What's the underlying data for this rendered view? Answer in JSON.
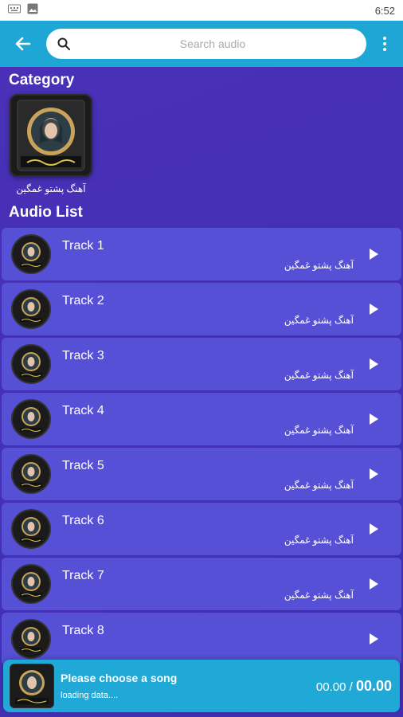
{
  "status_bar": {
    "time": "6:52"
  },
  "search": {
    "placeholder": "Search audio"
  },
  "category": {
    "heading": "Category",
    "items": [
      {
        "name": "آهنگ پشتو غمگین"
      }
    ]
  },
  "audio_list": {
    "heading": "Audio List",
    "tracks": [
      {
        "title": "Track 1",
        "subtitle": "آهنگ پشتو غمگین"
      },
      {
        "title": "Track 2",
        "subtitle": "آهنگ پشتو غمگین"
      },
      {
        "title": "Track 3",
        "subtitle": "آهنگ پشتو غمگین"
      },
      {
        "title": "Track 4",
        "subtitle": "آهنگ پشتو غمگین"
      },
      {
        "title": "Track 5",
        "subtitle": "آهنگ پشتو غمگین"
      },
      {
        "title": "Track 6",
        "subtitle": "آهنگ پشتو غمگین"
      },
      {
        "title": "Track 7",
        "subtitle": "آهنگ پشتو غمگین"
      },
      {
        "title": "Track 8",
        "subtitle": ""
      }
    ]
  },
  "player": {
    "title": "Please choose a song",
    "status": "loading data....",
    "current_time": "00.00",
    "separator": "/",
    "duration": "00.00"
  },
  "colors": {
    "app_bar": "#1ea7d4",
    "background": "#4530b5",
    "track_row": "#5650d6",
    "player": "#20a8d6"
  },
  "icons": {
    "back": "arrow-left-icon",
    "search": "search-icon",
    "more": "more-vert-icon",
    "play": "play-icon"
  }
}
